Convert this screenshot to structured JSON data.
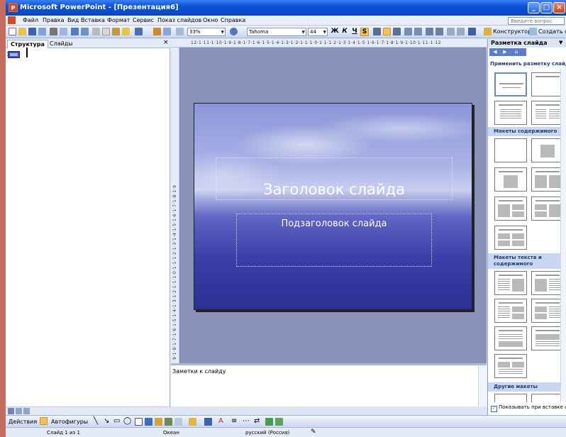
{
  "window": {
    "title": "Microsoft PowerPoint - [Презентация6]",
    "icon": "powerpoint-app-icon",
    "controls": [
      "_",
      "□",
      "×"
    ]
  },
  "menu": {
    "items": [
      "Файл",
      "Правка",
      "Вид",
      "Вставка",
      "Формат",
      "Сервис",
      "Показ слайдов",
      "Окно",
      "Справка"
    ],
    "ask_placeholder": "Введите вопрос"
  },
  "toolbar": {
    "zoom": "33%",
    "font_name": "Tahoma",
    "font_size": "44",
    "bold": "Ж",
    "italic": "К",
    "underline": "Ч",
    "shadow": "S",
    "constructor_label": "Конструктор",
    "new_slide_label": "Создать слайд"
  },
  "outline_pane": {
    "tabs": [
      "Структура",
      "Слайды"
    ],
    "close": "×",
    "slide_number": "1"
  },
  "ruler": {
    "horizontal": "12·1·11·1·10·1·9·1·8·1·7·1·6·1·5·1·4·1·3·1·2·1·1·1·0·1·1·1·2·1·3·1·4·1·5·1·6·1·7·1·8·1·9·1·10·1·11·1·12",
    "vertical": "9·1·8·1·7·1·6·1·5·1·4·1·3·1·2·1·1·1·0·1·1·1·2·1·3·1·4·1·5·1·6·1·7·1·8·1·9"
  },
  "slide": {
    "title": "Заголовок слайда",
    "subtitle": "Подзаголовок слайда"
  },
  "notes": {
    "placeholder": "Заметки к слайду"
  },
  "task_pane": {
    "title": "Разметка слайда",
    "apply_label": "Применить разметку слайда:",
    "sections": {
      "content": "Макеты содержимого",
      "text_content": "Макеты текста и содержимого",
      "other": "Другие макеты"
    },
    "show_on_insert": "Показывать при вставке слайдов"
  },
  "drawing": {
    "actions": "Действия",
    "autoshapes": "Автофигуры"
  },
  "status": {
    "slide": "Слайд 1 из 1",
    "design": "Океан",
    "language": "русский (Россия)"
  },
  "colors": {
    "title_bar": "#0a52d8",
    "work_area": "#8a91b7",
    "slide_blue": "#3a3fa8"
  }
}
